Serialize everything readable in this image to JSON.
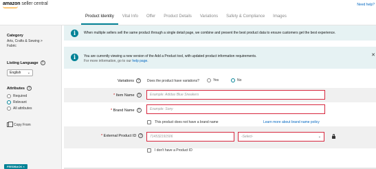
{
  "header": {
    "logo_bold": "amazon",
    "logo_rest": " seller central",
    "help": "Need help?"
  },
  "tabs": [
    {
      "label": "Product Identity",
      "active": true
    },
    {
      "label": "Vital Info",
      "active": false
    },
    {
      "label": "Offer",
      "active": false
    },
    {
      "label": "Product Details",
      "active": false
    },
    {
      "label": "Variations",
      "active": false
    },
    {
      "label": "Safety & Compliance",
      "active": false
    },
    {
      "label": "Images",
      "active": false
    }
  ],
  "sidebar": {
    "category_heading": "Category",
    "category_path": "Arts, Crafts & Sewing  >",
    "category_leaf": "Fabric",
    "language_heading": "Listing Language",
    "language_value": "English",
    "attributes_heading": "Attributes",
    "attributes_options": [
      {
        "label": "Required",
        "selected": false
      },
      {
        "label": "Relevant",
        "selected": true
      },
      {
        "label": "All attributes",
        "selected": false
      }
    ],
    "copy_from": "Copy From"
  },
  "banners": {
    "first": "When multiple sellers sell the same product through a single detail page, we combine and present the best product data to ensure customers get the best experience.",
    "second": "You are currently viewing a new version of the Add a Product tool, with updated product information requirements.",
    "second_sub_prefix": "For more information, go to our ",
    "second_sub_link": "help page."
  },
  "form": {
    "variations_label": "Variations",
    "variations_question": "Does the product have variations?",
    "variations_yes": "Yes",
    "variations_no": "No",
    "variations_selected": "No",
    "item_name_label": "Item Name",
    "item_name_placeholder": "Example: Adidas Blue Sneakers",
    "brand_name_label": "Brand Name",
    "brand_name_placeholder": "Example: Sony",
    "no_brand_checkbox": "This product does not have a brand name",
    "brand_link": "Learn more about brand name policy",
    "external_id_label": "External Product ID",
    "external_id_placeholder": "714532191506",
    "external_id_type": "-Select-",
    "no_product_id_checkbox": "I don't have a Product ID",
    "required_mark": "*"
  },
  "feedback": "FEEDBACK",
  "icons": {
    "info": "info-icon",
    "help": "question-circle-icon",
    "close": "close-icon",
    "lock": "lock-icon",
    "copy": "copy-icon"
  },
  "colors": {
    "accent": "#008296",
    "error_border": "#d7263d",
    "banner_bg": "#e6f2f3",
    "link": "#0066c0"
  }
}
